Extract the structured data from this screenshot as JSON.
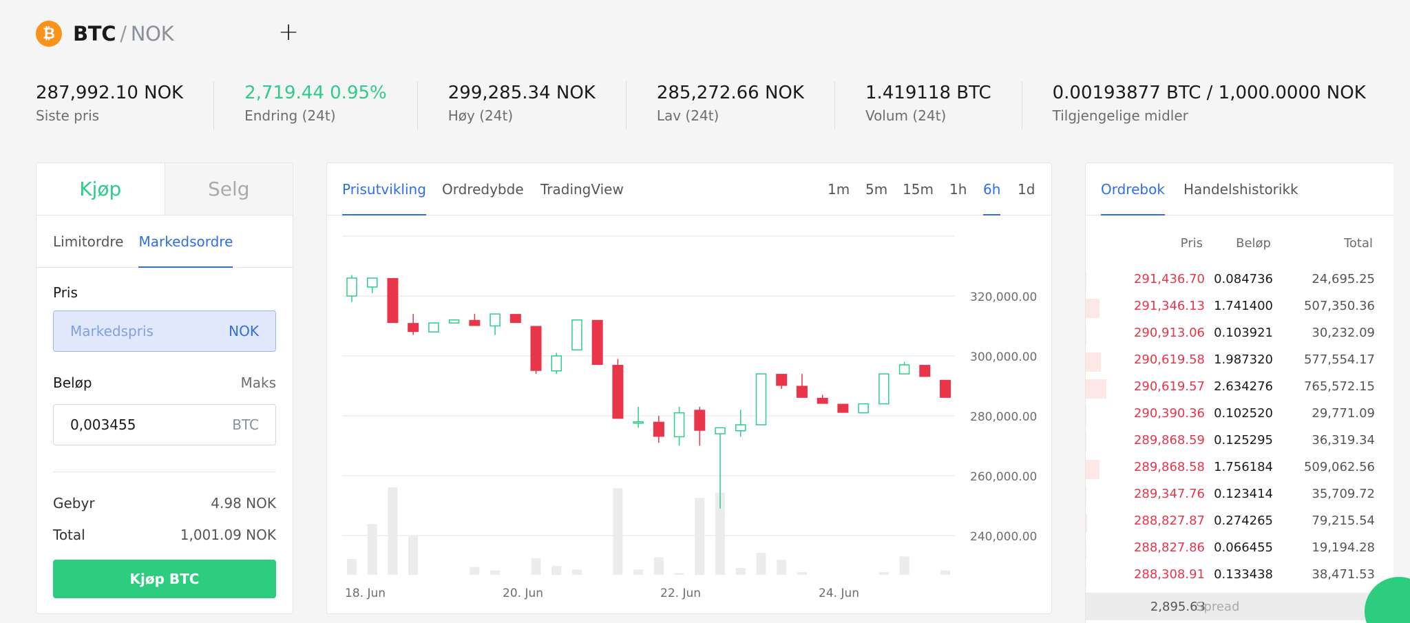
{
  "header": {
    "base": "BTC",
    "sep": "/",
    "quote": "NOK",
    "logo_glyph": "₿",
    "add_glyph": "+"
  },
  "stats": [
    {
      "value": "287,992.10 NOK",
      "label": "Siste pris"
    },
    {
      "value": "2,719.44 0.95%",
      "label": "Endring (24t)"
    },
    {
      "value": "299,285.34 NOK",
      "label": "Høy (24t)"
    },
    {
      "value": "285,272.66 NOK",
      "label": "Lav (24t)"
    },
    {
      "value": "1.419118 BTC",
      "label": "Volum (24t)"
    },
    {
      "value": "0.00193877 BTC / 1,000.0000 NOK",
      "label": "Tilgjengelige midler"
    }
  ],
  "order": {
    "buy_tab": "Kjøp",
    "sell_tab": "Selg",
    "limit_tab": "Limitordre",
    "market_tab": "Markedsordre",
    "price_label": "Pris",
    "price_placeholder": "Markedspris",
    "price_currency": "NOK",
    "amount_label": "Beløp",
    "max_label": "Maks",
    "amount_value": "0,003455",
    "amount_currency": "BTC",
    "fee_label": "Gebyr",
    "fee_value": "4.98 NOK",
    "total_label": "Total",
    "total_value": "1,001.09 NOK",
    "buy_button": "Kjøp BTC"
  },
  "chart_tabs": [
    "Prisutvikling",
    "Ordredybde",
    "TradingView"
  ],
  "intervals": [
    "1m",
    "5m",
    "15m",
    "1h",
    "6h",
    "1d"
  ],
  "active_interval": "6h",
  "chart_data": {
    "type": "candlestick",
    "y_ticks": [
      240000,
      260000,
      280000,
      300000,
      320000
    ],
    "y_tick_labels": [
      "240,000.00",
      "260,000.00",
      "280,000.00",
      "300,000.00",
      "320,000.00"
    ],
    "x_ticks": [
      "18. Jun",
      "20. Jun",
      "22. Jun",
      "24. Jun"
    ],
    "candles": [
      {
        "o": 320000,
        "h": 327000,
        "l": 318000,
        "c": 326000
      },
      {
        "o": 323000,
        "h": 326000,
        "l": 321000,
        "c": 326000
      },
      {
        "o": 326000,
        "h": 326000,
        "l": 311000,
        "c": 311000
      },
      {
        "o": 311000,
        "h": 314000,
        "l": 307000,
        "c": 308000
      },
      {
        "o": 308000,
        "h": 311000,
        "l": 308000,
        "c": 311000
      },
      {
        "o": 311000,
        "h": 312000,
        "l": 311000,
        "c": 312000
      },
      {
        "o": 312000,
        "h": 314000,
        "l": 310000,
        "c": 310000
      },
      {
        "o": 310000,
        "h": 314000,
        "l": 307000,
        "c": 314000
      },
      {
        "o": 314000,
        "h": 314000,
        "l": 311000,
        "c": 311000
      },
      {
        "o": 310000,
        "h": 310000,
        "l": 294000,
        "c": 295000
      },
      {
        "o": 295000,
        "h": 301000,
        "l": 294000,
        "c": 300000
      },
      {
        "o": 302000,
        "h": 312000,
        "l": 302000,
        "c": 312000
      },
      {
        "o": 312000,
        "h": 312000,
        "l": 297000,
        "c": 297000
      },
      {
        "o": 297000,
        "h": 299000,
        "l": 279000,
        "c": 279000
      },
      {
        "o": 278000,
        "h": 283000,
        "l": 276000,
        "c": 278000
      },
      {
        "o": 278000,
        "h": 280000,
        "l": 271000,
        "c": 273000
      },
      {
        "o": 273000,
        "h": 283000,
        "l": 270000,
        "c": 281000
      },
      {
        "o": 282000,
        "h": 283000,
        "l": 270000,
        "c": 275000
      },
      {
        "o": 274000,
        "h": 275000,
        "l": 249000,
        "c": 276000
      },
      {
        "o": 275000,
        "h": 282000,
        "l": 273000,
        "c": 277000
      },
      {
        "o": 277000,
        "h": 294000,
        "l": 277000,
        "c": 294000
      },
      {
        "o": 294000,
        "h": 294000,
        "l": 289000,
        "c": 290000
      },
      {
        "o": 290000,
        "h": 294000,
        "l": 286000,
        "c": 286000
      },
      {
        "o": 286000,
        "h": 287000,
        "l": 284000,
        "c": 284000
      },
      {
        "o": 284000,
        "h": 284000,
        "l": 281000,
        "c": 281000
      },
      {
        "o": 281000,
        "h": 284000,
        "l": 281000,
        "c": 284000
      },
      {
        "o": 284000,
        "h": 294000,
        "l": 284000,
        "c": 294000
      },
      {
        "o": 294000,
        "h": 298000,
        "l": 294000,
        "c": 297000
      },
      {
        "o": 297000,
        "h": 297000,
        "l": 293000,
        "c": 293000
      },
      {
        "o": 292000,
        "h": 292000,
        "l": 286000,
        "c": 286000
      }
    ],
    "volumes": [
      0.18,
      0.58,
      1.0,
      0.45,
      0,
      0,
      0.09,
      0.05,
      0,
      0.19,
      0.1,
      0.06,
      0,
      0.99,
      0.06,
      0.2,
      0.02,
      0.88,
      0.94,
      0.08,
      0.25,
      0.17,
      0.03,
      0,
      0,
      0,
      0.03,
      0.21,
      0,
      0.05
    ],
    "colors": {
      "up": "#2ecc8a",
      "down": "#e8354a",
      "volume": "#ececec",
      "grid": "#e6e6e6"
    }
  },
  "book": {
    "tab_orderbook": "Ordrebok",
    "tab_history": "Handelshistorikk",
    "col_price": "Pris",
    "col_amount": "Beløp",
    "col_total": "Total",
    "rows": [
      {
        "price": "291,436.70",
        "amount": "0.084736",
        "total": "24,695.25",
        "depth": 0.02
      },
      {
        "price": "291,346.13",
        "amount": "1.741400",
        "total": "507,350.36",
        "depth": 0.62
      },
      {
        "price": "290,913.06",
        "amount": "0.103921",
        "total": "30,232.09",
        "depth": 0.02
      },
      {
        "price": "290,619.58",
        "amount": "1.987320",
        "total": "577,554.17",
        "depth": 0.69
      },
      {
        "price": "290,619.57",
        "amount": "2.634276",
        "total": "765,572.15",
        "depth": 0.93
      },
      {
        "price": "290,390.36",
        "amount": "0.102520",
        "total": "29,771.09",
        "depth": 0.02
      },
      {
        "price": "289,868.59",
        "amount": "0.125295",
        "total": "36,319.34",
        "depth": 0.02
      },
      {
        "price": "289,868.58",
        "amount": "1.756184",
        "total": "509,062.56",
        "depth": 0.62
      },
      {
        "price": "289,347.76",
        "amount": "0.123414",
        "total": "35,709.72",
        "depth": 0.02
      },
      {
        "price": "288,827.87",
        "amount": "0.274265",
        "total": "79,215.54",
        "depth": 0.06
      },
      {
        "price": "288,827.86",
        "amount": "0.066455",
        "total": "19,194.28",
        "depth": 0.02
      },
      {
        "price": "288,308.91",
        "amount": "0.133438",
        "total": "38,471.53",
        "depth": 0.02
      }
    ],
    "spread_value": "2,895.63",
    "spread_label": "Spread"
  }
}
